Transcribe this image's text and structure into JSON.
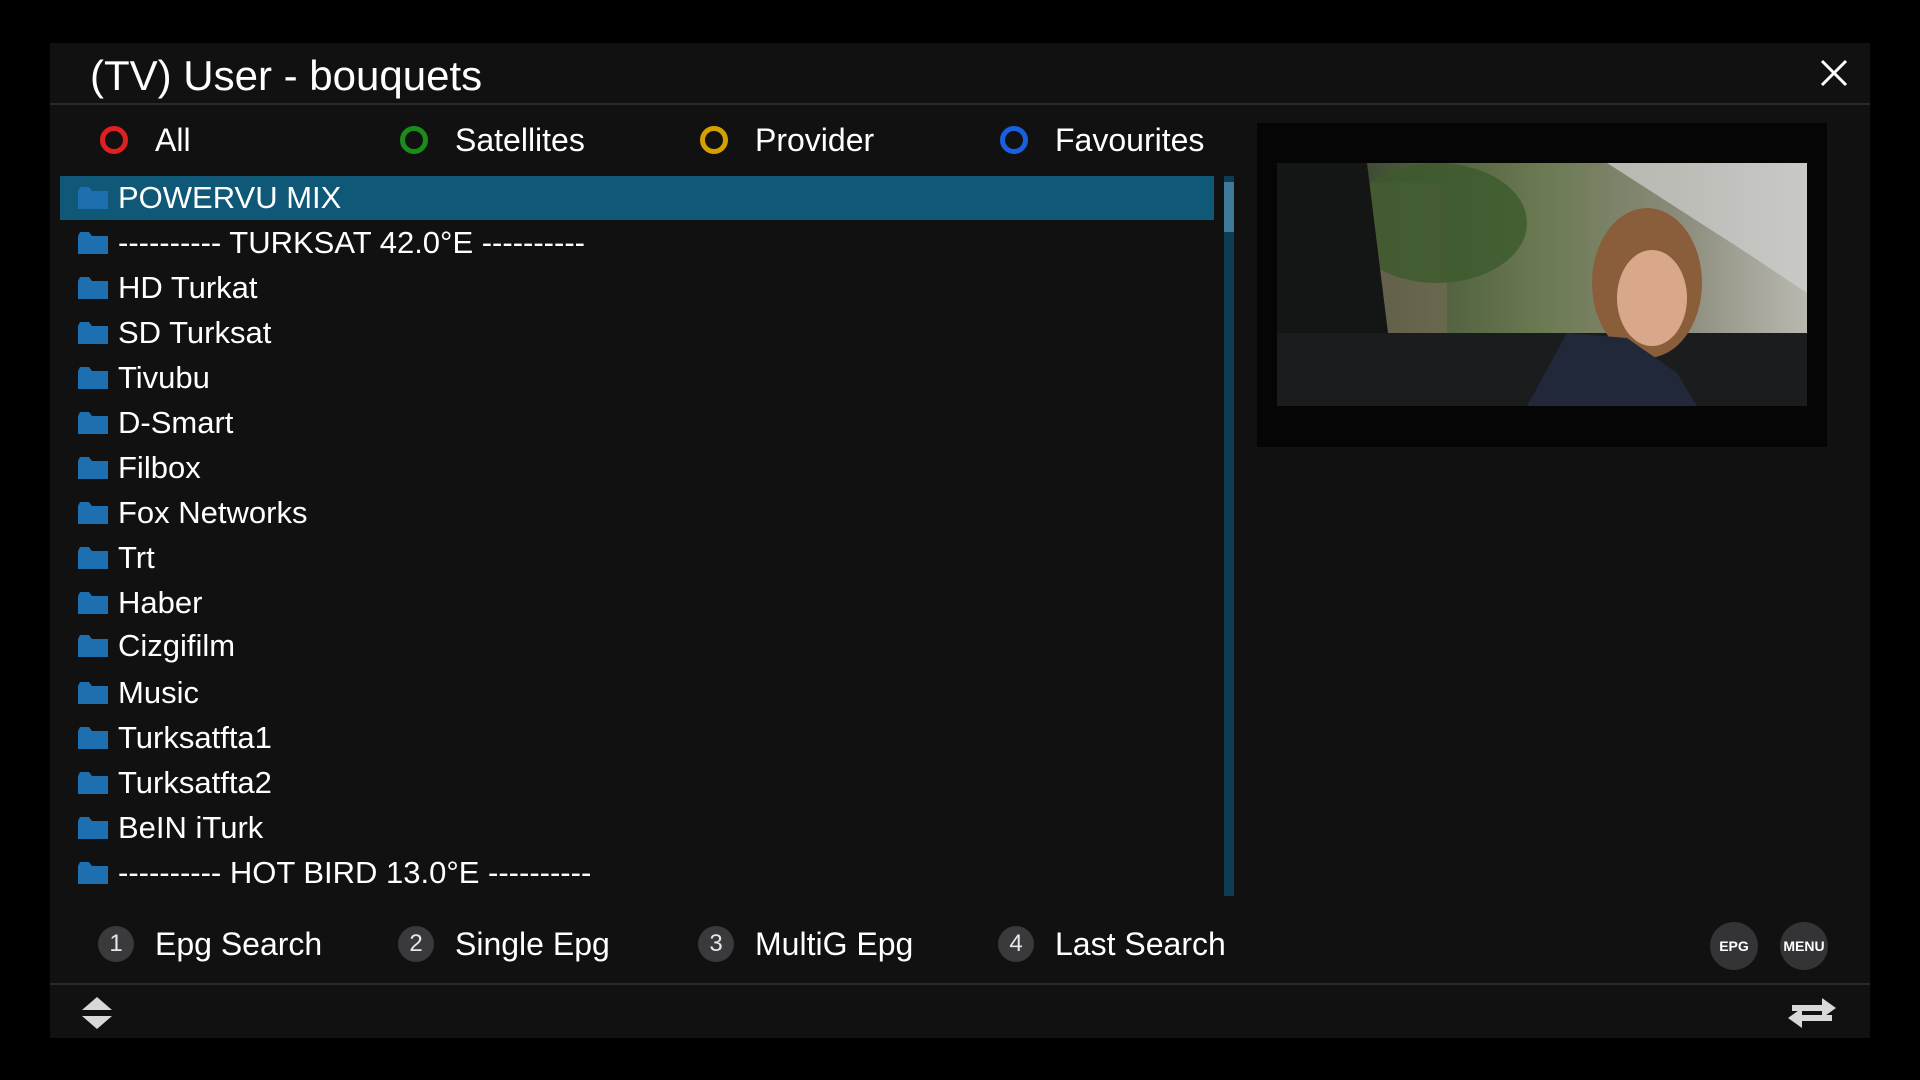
{
  "title": "(TV) User - bouquets",
  "color_tabs": [
    {
      "label": "All",
      "color": "#e02020"
    },
    {
      "label": "Satellites",
      "color": "#1a8c1a"
    },
    {
      "label": "Provider",
      "color": "#d4a000"
    },
    {
      "label": "Favourites",
      "color": "#1a5fe0"
    }
  ],
  "bouquets": [
    {
      "label": "POWERVU MIX",
      "selected": true
    },
    {
      "label": "---------- TURKSAT 42.0°E ----------"
    },
    {
      "label": "HD Turkat"
    },
    {
      "label": "SD Turksat"
    },
    {
      "label": "Tivubu"
    },
    {
      "label": "D-Smart"
    },
    {
      "label": "Filbox"
    },
    {
      "label": "Fox Networks"
    },
    {
      "label": "Trt"
    },
    {
      "label": "Haber"
    },
    {
      "label": "Cizgifilm"
    },
    {
      "label": "Music"
    },
    {
      "label": "Turksatfta1"
    },
    {
      "label": "Turksatfta2"
    },
    {
      "label": "BeIN iTurk"
    },
    {
      "label": "---------- HOT BIRD 13.0°E ----------"
    }
  ],
  "number_keys": [
    {
      "num": "1",
      "label": "Epg Search"
    },
    {
      "num": "2",
      "label": "Single Epg"
    },
    {
      "num": "3",
      "label": "MultiG Epg"
    },
    {
      "num": "4",
      "label": "Last Search"
    }
  ],
  "buttons": {
    "epg": "EPG",
    "menu": "MENU"
  },
  "colors": {
    "selection": "#0f5877",
    "folder": "#1e6fb0",
    "panel": "#111112"
  },
  "icons": {
    "close": "close-icon",
    "folder": "folder-icon",
    "updown": "up-down-arrows-icon",
    "swap": "swap-arrows-icon"
  }
}
